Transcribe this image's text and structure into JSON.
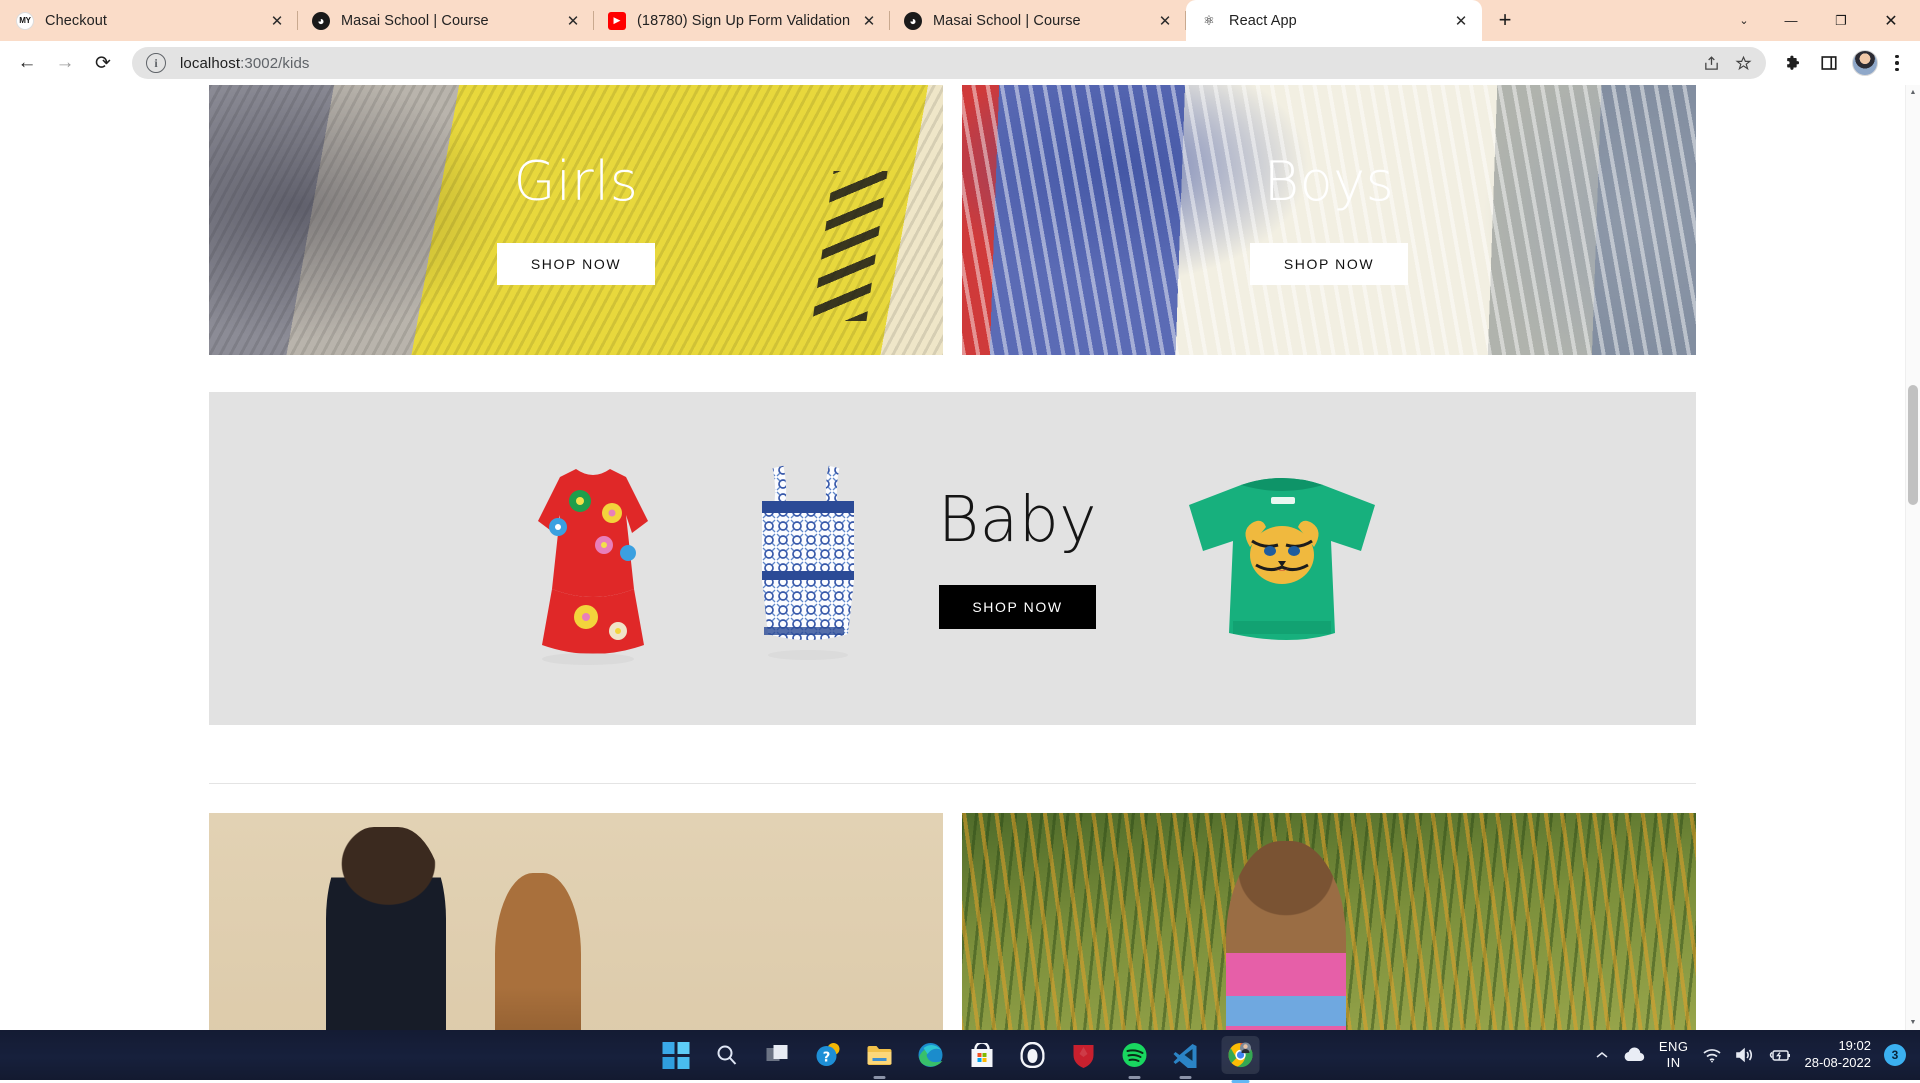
{
  "window": {
    "minimize_label": "—",
    "maximize_label": "❐",
    "close_label": "✕",
    "chevron_label": "⌄"
  },
  "tabs": [
    {
      "title": "Checkout",
      "favicon": "my-logo-icon",
      "favicon_text": "MY",
      "active": false,
      "close_label": "✕"
    },
    {
      "title": "Masai School | Course",
      "favicon": "masai-globe-icon",
      "favicon_text": "◕",
      "active": false,
      "close_label": "✕"
    },
    {
      "title": "(18780) Sign Up Form Validation",
      "favicon": "youtube-icon",
      "favicon_text": "▶",
      "active": false,
      "close_label": "✕"
    },
    {
      "title": "Masai School | Course",
      "favicon": "masai-globe-icon",
      "favicon_text": "◕",
      "active": false,
      "close_label": "✕"
    },
    {
      "title": "React App",
      "favicon": "react-icon",
      "favicon_text": "⚛",
      "active": true,
      "close_label": "✕"
    }
  ],
  "newtab": {
    "label": "+"
  },
  "toolbar": {
    "back_label": "←",
    "forward_label": "→",
    "reload_label": "⟳",
    "site_info_label": "i",
    "url_primary": "localhost",
    "url_secondary": ":3002/kids",
    "url_full": "localhost:3002/kids",
    "share_label": "⇪",
    "bookmark_label": "☆",
    "extensions_label": "🧩",
    "sidepanel_label": "▣",
    "profile_label": "profile",
    "menu_label": "⋮"
  },
  "page": {
    "hero": [
      {
        "title": "Girls",
        "button": "SHOP NOW",
        "image": "girl-yellow-hoodie-photo"
      },
      {
        "title": "Boys",
        "button": "SHOP NOW",
        "image": "boy-striped-shirt-photo"
      }
    ],
    "baby": {
      "title": "Baby",
      "button": "SHOP NOW",
      "products": [
        {
          "name": "red-flower-dress"
        },
        {
          "name": "blue-print-romper"
        },
        {
          "name": "green-tiger-sweatshirt"
        }
      ]
    },
    "bottom": [
      {
        "image": "two-girls-studio-photo"
      },
      {
        "image": "girl-in-field-photo"
      }
    ]
  },
  "scrollbar": {
    "up_label": "▲",
    "down_label": "▼"
  },
  "taskbar": {
    "apps": [
      {
        "name": "start-button",
        "label": "Windows"
      },
      {
        "name": "search-icon",
        "label": "Search"
      },
      {
        "name": "task-view-icon",
        "label": "Task View"
      },
      {
        "name": "widgets-icon",
        "label": "Widgets"
      },
      {
        "name": "file-explorer-icon",
        "label": "File Explorer"
      },
      {
        "name": "microsoft-edge-icon",
        "label": "Microsoft Edge"
      },
      {
        "name": "microsoft-store-icon",
        "label": "Microsoft Store"
      },
      {
        "name": "arc-browser-icon",
        "label": "Arc"
      },
      {
        "name": "mcafee-icon",
        "label": "McAfee"
      },
      {
        "name": "spotify-icon",
        "label": "Spotify"
      },
      {
        "name": "vscode-icon",
        "label": "Visual Studio Code"
      },
      {
        "name": "google-chrome-icon",
        "label": "Google Chrome"
      }
    ],
    "tray": {
      "overflow_label": "⌃",
      "onedrive_label": "OneDrive",
      "language_line1": "ENG",
      "language_line2": "IN",
      "wifi_label": "Wi-Fi",
      "volume_label": "Volume",
      "battery_label": "Battery charging",
      "time": "19:02",
      "date": "28-08-2022",
      "notification_count": "3"
    }
  },
  "colors": {
    "tabstrip": "#fadcc8",
    "band_background": "#e2e2e2",
    "baby_button": "#000000",
    "taskbar": "#141b33",
    "notification_badge": "#3bb0f0"
  }
}
